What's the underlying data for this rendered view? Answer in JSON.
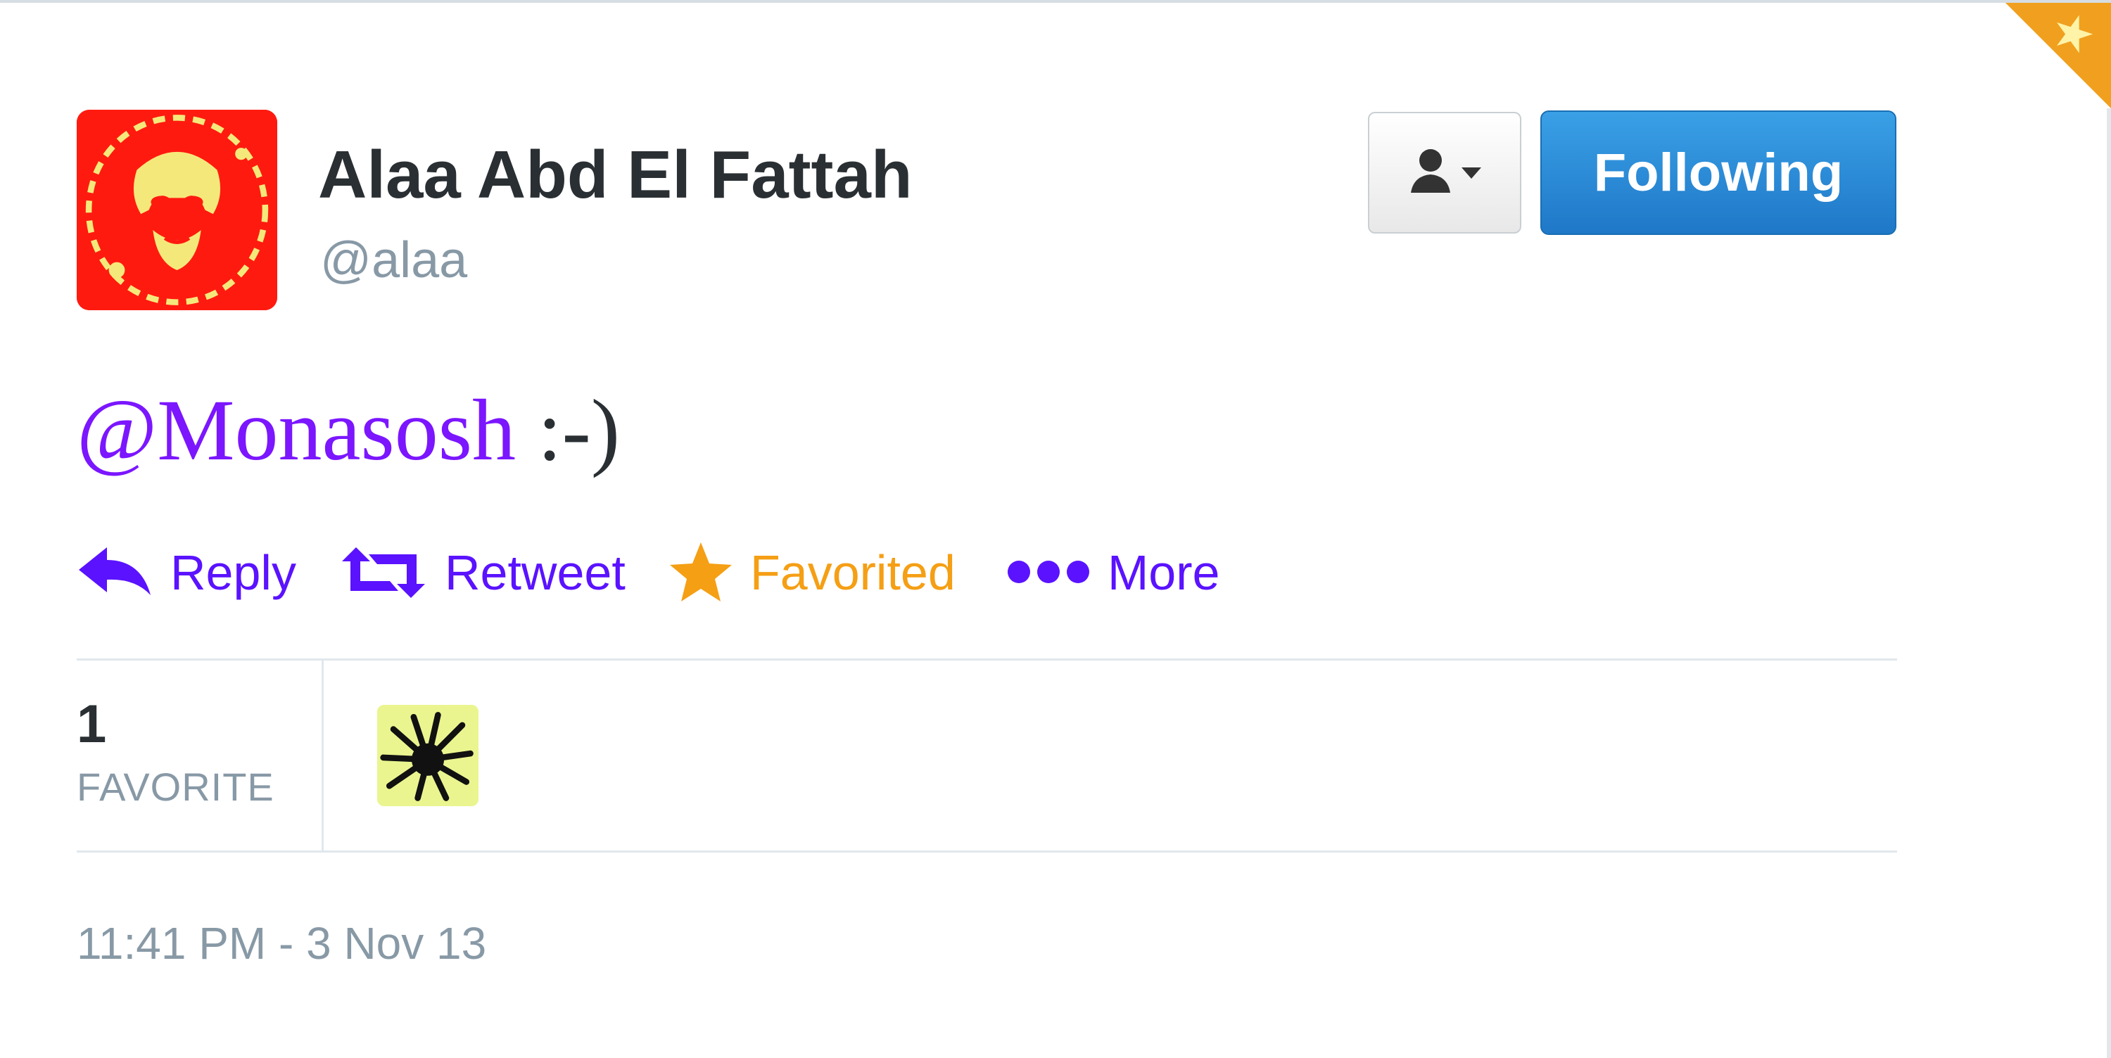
{
  "author": {
    "fullname": "Alaa Abd El Fattah",
    "handle": "@alaa",
    "avatar_icon": "user-avatar",
    "avatar_colors": {
      "background": "#ff1a10",
      "face": "#f5e87a"
    }
  },
  "header": {
    "user_menu_icon": "person-dropdown-icon",
    "follow_button_label": "Following"
  },
  "tweet": {
    "mention": "@Monasosh",
    "text_rest": " :-)"
  },
  "actions": {
    "reply": {
      "label": "Reply",
      "icon": "reply-icon"
    },
    "retweet": {
      "label": "Retweet",
      "icon": "retweet-icon"
    },
    "favorite": {
      "label": "Favorited",
      "icon": "star-icon"
    },
    "more": {
      "label": "More",
      "icon": "ellipsis-icon"
    }
  },
  "stats": {
    "favorite_count": "1",
    "favorite_label": "FAVORITE"
  },
  "timestamp": "11:41 PM - 3 Nov 13",
  "colors": {
    "link": "#5a12ff",
    "favorited": "#f59f15",
    "following_button": "#1f78c8",
    "text": "#292f33",
    "muted": "#8899a6"
  }
}
